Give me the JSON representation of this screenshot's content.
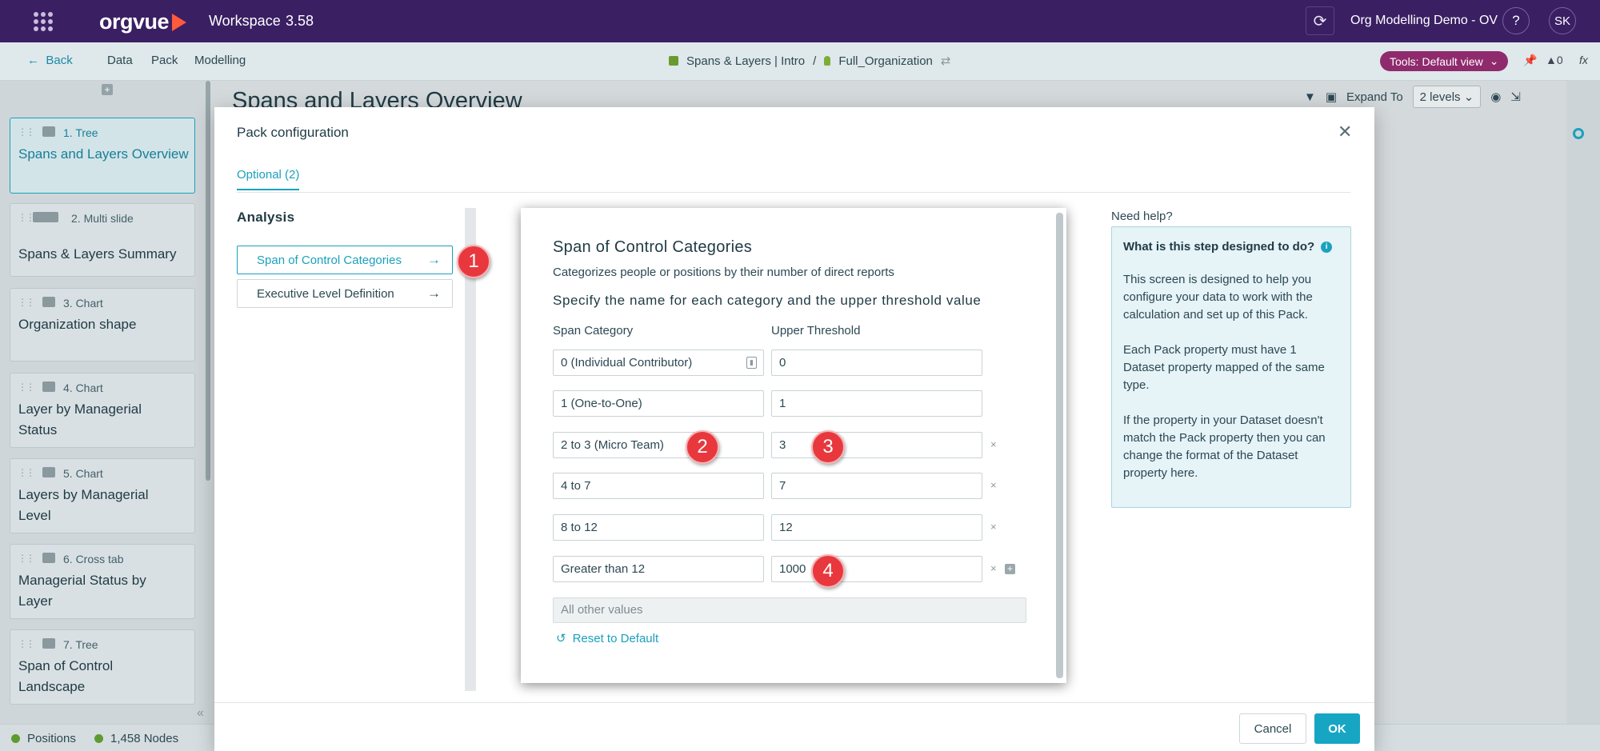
{
  "topbar": {
    "logo": "orgvue",
    "workspace_title": "Workspace",
    "workspace_version": "3.58",
    "org_name": "Org Modelling Demo - OV",
    "help": "?",
    "avatar": "SK"
  },
  "navbar": {
    "back": "Back",
    "items": [
      "Data",
      "Pack",
      "Modelling"
    ],
    "breadcrumb_pack": "Spans & Layers | Intro",
    "breadcrumb_sep": "/",
    "breadcrumb_dataset": "Full_Organization",
    "tools_label": "Tools: Default view",
    "warnings": "0",
    "fx": "fx"
  },
  "sidebar": {
    "cards": [
      {
        "type": "1. Tree",
        "title": "Spans and Layers Overview",
        "active": true
      },
      {
        "type": "2. Multi slide",
        "title": "Spans & Layers Summary"
      },
      {
        "type": "3. Chart",
        "title": "Organization shape"
      },
      {
        "type": "4. Chart",
        "title": "Layer by Managerial Status"
      },
      {
        "type": "5. Chart",
        "title": "Layers by Managerial Level"
      },
      {
        "type": "6. Cross tab",
        "title": "Managerial Status by Layer"
      },
      {
        "type": "7. Tree",
        "title": "Span of Control Landscape"
      }
    ]
  },
  "statusbar": {
    "positions": "Positions",
    "nodes": "1,458 Nodes"
  },
  "background": {
    "page_title": "Spans and Layers Overview",
    "expand_to": "Expand To",
    "levels": "2 levels"
  },
  "modal": {
    "title": "Pack configuration",
    "tab": "Optional (2)",
    "analysis_label": "Analysis",
    "steps": [
      {
        "label": "Span of Control Categories",
        "active": true
      },
      {
        "label": "Executive Level Definition"
      }
    ],
    "markers": [
      "1",
      "2",
      "3",
      "4"
    ],
    "panel": {
      "title": "Span of Control Categories",
      "description": "Categorizes people or positions by their number of direct reports",
      "spec": "Specify the name for each category and the upper threshold value",
      "col_category": "Span Category",
      "col_threshold": "Upper Threshold",
      "rows": [
        {
          "category": "0 (Individual Contributor)",
          "threshold": "0"
        },
        {
          "category": "1 (One-to-One)",
          "threshold": "1"
        },
        {
          "category": "2 to 3 (Micro Team)",
          "threshold": "3"
        },
        {
          "category": "4 to 7",
          "threshold": "7"
        },
        {
          "category": "8 to 12",
          "threshold": "12"
        },
        {
          "category": "Greater than 12",
          "threshold": "1000"
        }
      ],
      "remove_symbol": "×",
      "other_values": "All other values",
      "reset": "Reset to Default"
    },
    "help": {
      "heading": "Need help?",
      "question": "What is this step designed to do?",
      "p1": "This screen is designed to help you configure your data to work with the calculation and set up of this Pack.",
      "p2": "Each Pack property must have 1 Dataset property mapped of the same type.",
      "p3": "If the property in your Dataset doesn't match the Pack property then you can change the format of the Dataset property here."
    },
    "cancel": "Cancel",
    "ok": "OK"
  }
}
